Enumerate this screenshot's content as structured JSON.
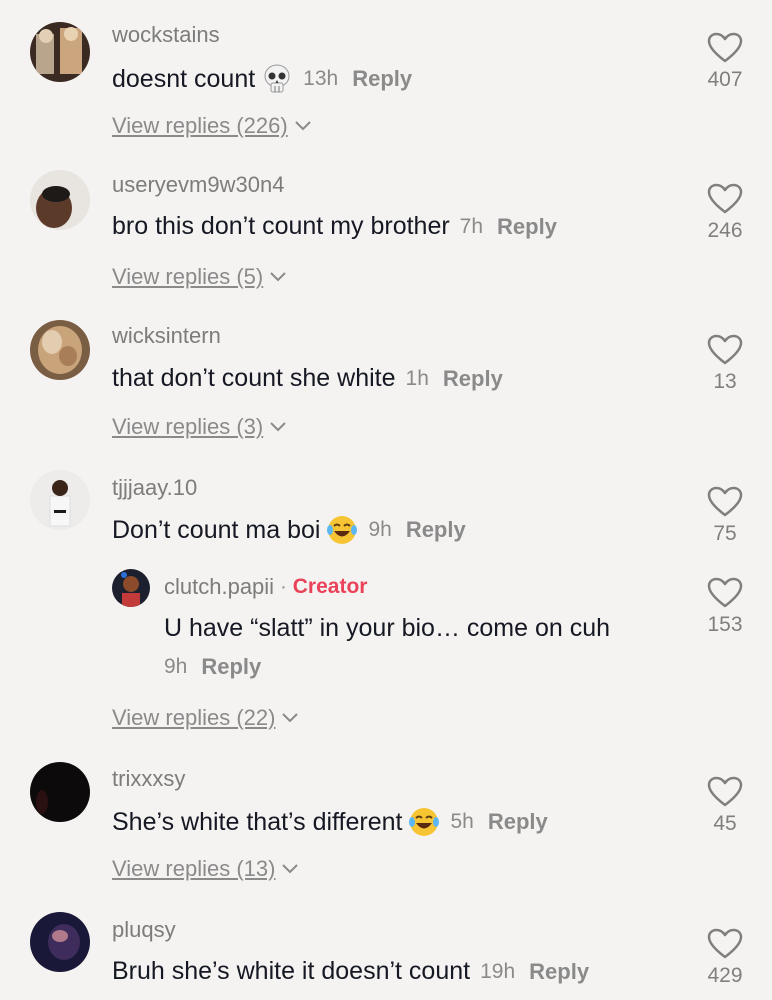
{
  "comments": [
    {
      "username": "wockstains",
      "text": "doesnt count",
      "emoji": "skull-emoji",
      "time": "13h",
      "reply_label": "Reply",
      "likes": "407",
      "view_replies": "View replies (226)"
    },
    {
      "username": "useryevm9w30n4",
      "text": "bro this don’t count my brother",
      "time": "7h",
      "reply_label": "Reply",
      "likes": "246",
      "view_replies": "View replies (5)"
    },
    {
      "username": "wicksintern",
      "text": "that don’t count she white",
      "time": "1h",
      "reply_label": "Reply",
      "likes": "13",
      "view_replies": "View replies (3)"
    },
    {
      "username": "tjjjaay.10",
      "text": "Don’t count ma boi",
      "emoji": "laughing-tears-emoji",
      "time": "9h",
      "reply_label": "Reply",
      "likes": "75",
      "view_replies": "View replies (22)",
      "reply": {
        "username": "clutch.papii",
        "separator": "·",
        "badge": "Creator",
        "text": "U have “slatt” in your bio… come on cuh",
        "time": "9h",
        "reply_label": "Reply",
        "likes": "153"
      }
    },
    {
      "username": "trixxxsy",
      "text": "She’s white that’s different",
      "emoji": "laughing-tears-emoji",
      "time": "5h",
      "reply_label": "Reply",
      "likes": "45",
      "view_replies": "View replies (13)"
    },
    {
      "username": "pluqsy",
      "text": "Bruh she’s white it doesn’t count",
      "time": "19h",
      "reply_label": "Reply",
      "likes": "429"
    }
  ],
  "colors": {
    "background": "#f5f3f1",
    "text": "#161823",
    "muted": "#8a8a8a",
    "creator": "#ea4359"
  }
}
